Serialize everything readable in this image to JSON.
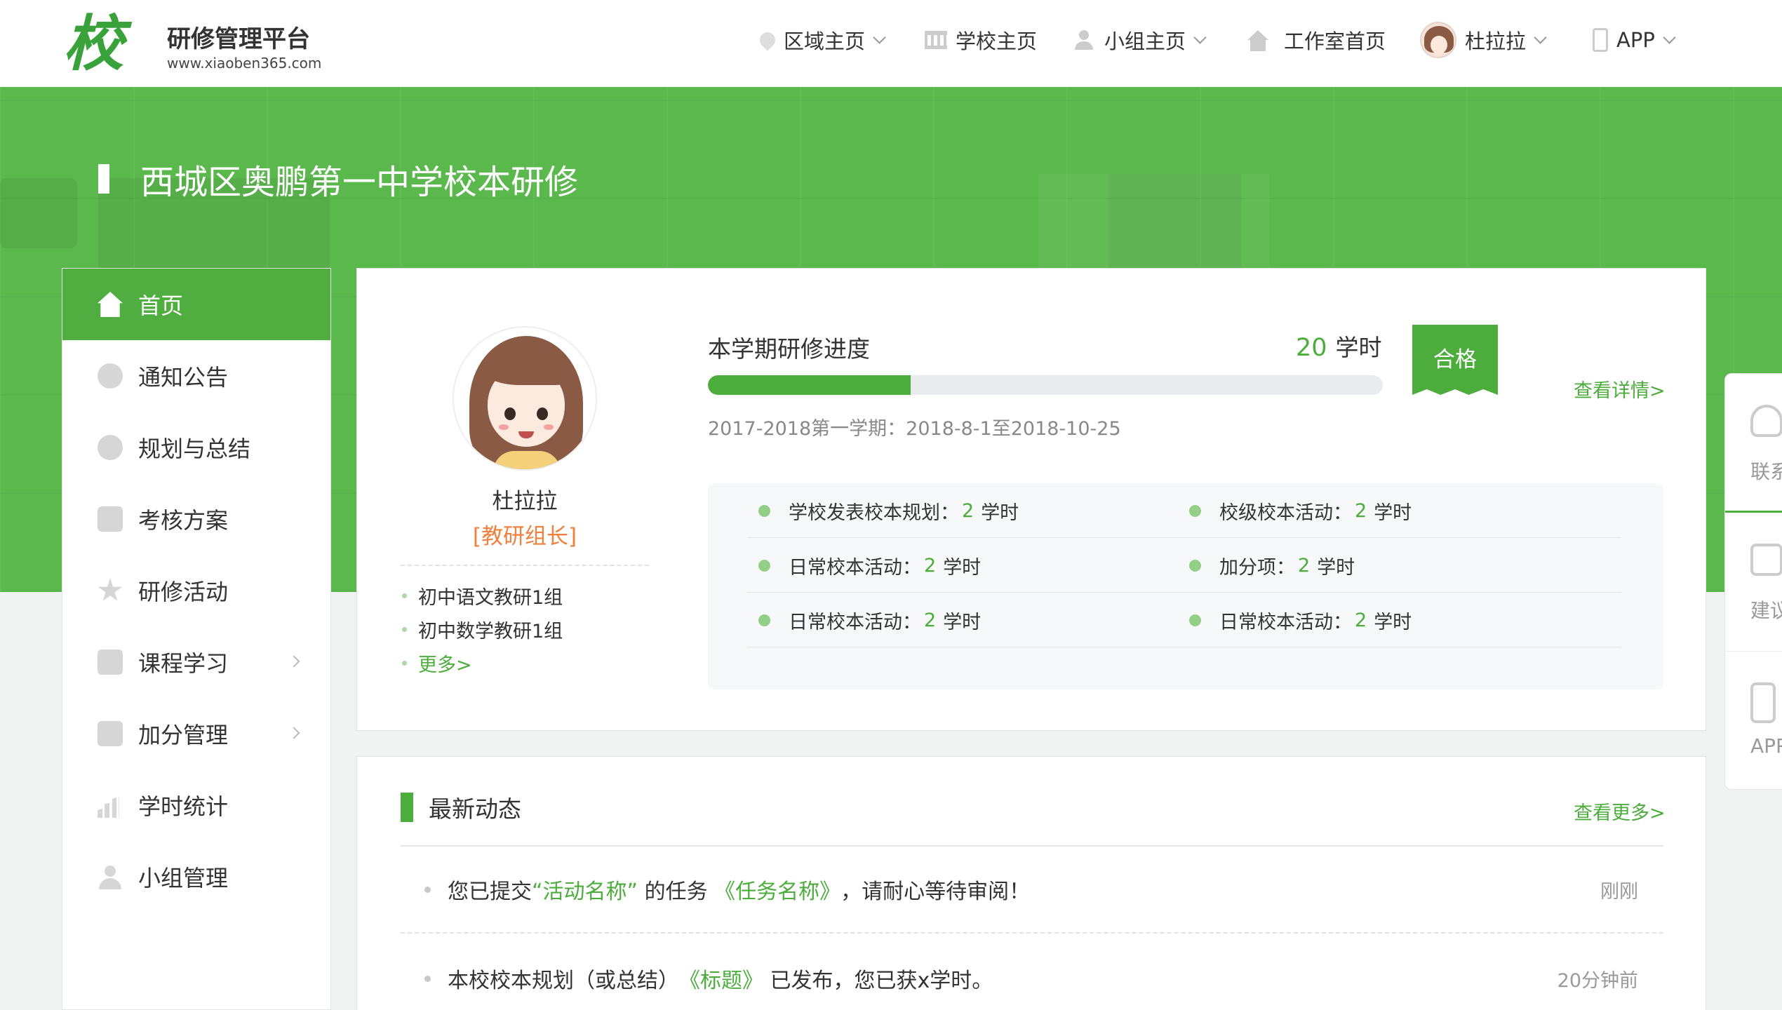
{
  "logo": {
    "mark": "校本",
    "title": "研修管理平台",
    "url": "www.xiaoben365.com"
  },
  "nav": {
    "items": [
      {
        "label": "区域主页",
        "icon": "location-pin-icon",
        "dropdown": true
      },
      {
        "label": "学校主页",
        "icon": "school-building-icon",
        "dropdown": false
      },
      {
        "label": "小组主页",
        "icon": "group-icon",
        "dropdown": true
      },
      {
        "label": "工作室首页",
        "icon": "home-icon",
        "dropdown": false
      }
    ],
    "user": {
      "name": "杜拉拉",
      "icon": "user-avatar-icon"
    },
    "app": {
      "label": "APP",
      "icon": "phone-icon"
    }
  },
  "banner": {
    "title": "西城区奥鹏第一中学校本研修"
  },
  "sidebar": {
    "items": [
      {
        "label": "首页",
        "icon": "home-icon",
        "active": true,
        "arrow": false
      },
      {
        "label": "通知公告",
        "icon": "bell-icon",
        "active": false,
        "arrow": false
      },
      {
        "label": "规划与总结",
        "icon": "pie-chart-icon",
        "active": false,
        "arrow": false
      },
      {
        "label": "考核方案",
        "icon": "document-icon",
        "active": false,
        "arrow": false
      },
      {
        "label": "研修活动",
        "icon": "star-icon",
        "active": false,
        "arrow": false
      },
      {
        "label": "课程学习",
        "icon": "course-book-icon",
        "active": false,
        "arrow": true
      },
      {
        "label": "加分管理",
        "icon": "coins-icon",
        "active": false,
        "arrow": true
      },
      {
        "label": "学时统计",
        "icon": "bar-chart-icon",
        "active": false,
        "arrow": false
      },
      {
        "label": "小组管理",
        "icon": "users-icon",
        "active": false,
        "arrow": false
      }
    ]
  },
  "profile": {
    "name": "杜拉拉",
    "role": "[教研组长]",
    "groups": [
      "初中语文教研1组",
      "初中数学教研1组"
    ],
    "more": "更多>"
  },
  "progress": {
    "title": "本学期研修进度",
    "hours_value": "20",
    "hours_unit": "学时",
    "fraction": 0.3,
    "semester": "2017-2018第一学期：2018-8-1至2018-10-25",
    "badge": "合格",
    "detail_link": "查看详情>"
  },
  "stats": {
    "rows": [
      [
        {
          "label": "学校发表校本规划：",
          "value": "2",
          "unit": "学时"
        },
        {
          "label": "校级校本活动：",
          "value": "2",
          "unit": "学时"
        }
      ],
      [
        {
          "label": "日常校本活动：",
          "value": "2",
          "unit": "学时"
        },
        {
          "label": "加分项：",
          "value": "2",
          "unit": "学时"
        }
      ],
      [
        {
          "label": "日常校本活动：",
          "value": "2",
          "unit": "学时"
        },
        {
          "label": "日常校本活动：",
          "value": "2",
          "unit": "学时"
        }
      ]
    ]
  },
  "feed": {
    "title": "最新动态",
    "more": "查看更多>",
    "items": [
      {
        "p1": "您已提交",
        "h1": "“活动名称”",
        "p2": " 的任务 ",
        "h2": "《任务名称》",
        "p3": " ，请耐心等待审阅！",
        "time": "刚刚"
      },
      {
        "p1": "本校校本规划（或总结）",
        "h1": "《标题》",
        "p2": " 已发布，您已获x学时。",
        "h2": "",
        "p3": "",
        "time": "20分钟前"
      }
    ]
  },
  "right_tools": [
    {
      "label": "联系",
      "icon": "headset-icon"
    },
    {
      "label": "建议",
      "icon": "feedback-icon"
    },
    {
      "label": "APP",
      "icon": "phone-icon"
    }
  ],
  "colors": {
    "brand_green": "#4cad3c",
    "banner_green": "#5bb84d",
    "role_orange": "#f0803c"
  }
}
